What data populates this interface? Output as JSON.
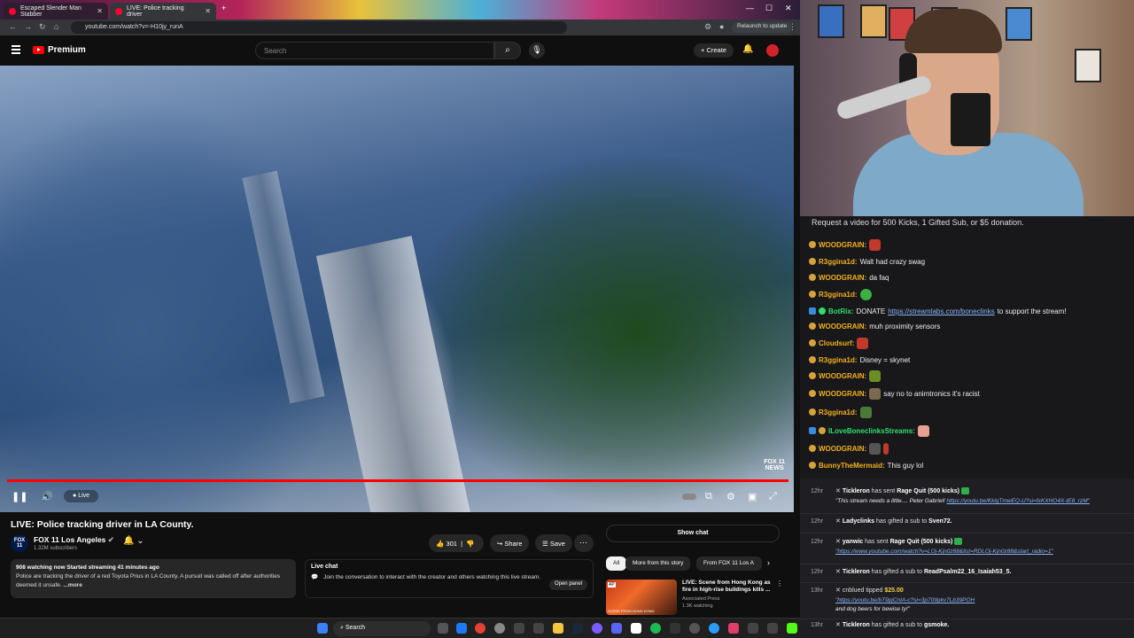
{
  "browser": {
    "tabs": [
      {
        "label": "Escaped Slender Man Stabber"
      },
      {
        "label": "LIVE: Police tracking driver"
      }
    ],
    "url": "youtube.com/watch?v=-H10jy_runA",
    "relaunch": "Relaunch to update"
  },
  "youtube": {
    "brand": "Premium",
    "search_placeholder": "Search",
    "create_label": "Create",
    "player": {
      "live_label": "Live",
      "watermark_line1": "FOX 11",
      "watermark_line2": "NEWS"
    },
    "video": {
      "title": "LIVE: Police tracking driver in LA County.",
      "channel_logo_top": "FOX",
      "channel_logo_bottom": "11",
      "channel": "FOX 11 Los Angeles",
      "subscribers": "1.32M subscribers",
      "likes": "301",
      "share_label": "Share",
      "save_label": "Save",
      "meta": "908 watching now  Started streaming 41 minutes ago",
      "description": "Police are tracking the driver of a red Toyota Prius in LA County. A pursuit was called off after authorities deemed it unsafe.",
      "more_label": "...more"
    },
    "live_chat_panel": {
      "title": "Live chat",
      "text": "Join the conversation to interact with the creator and others watching this live stream.",
      "open_panel": "Open panel"
    },
    "show_chat": "Show chat",
    "chips": [
      "All",
      "More from this story",
      "From FOX 11 Los A"
    ],
    "related": {
      "thumb_badge": "AP",
      "thumb_caption": "SCENE FROM HONG KONG",
      "title": "LIVE: Scene from Hong Kong as fire in high-rise buildings kills ...",
      "channel": "Associated Press",
      "watching": "1.3K watching"
    }
  },
  "taskbar": {
    "search": "Search"
  },
  "chat": {
    "rules_banner": "Request a video for 500 Kicks, 1 Gifted Sub, or $5 donation.",
    "messages": [
      {
        "user": "WOODGRAIN:",
        "text": "",
        "color": "#f2b01e"
      },
      {
        "user": "R3ggina1d:",
        "text": "Walt had crazy swag",
        "color": "#f2b01e"
      },
      {
        "user": "WOODGRAIN:",
        "text": "da faq",
        "color": "#f2b01e"
      },
      {
        "user": "R3ggina1d:",
        "text": "",
        "color": "#f2b01e"
      },
      {
        "user": "BotRix:",
        "text": "DONATE",
        "link": "https://streamlabs.com/boneclinks",
        "text2": "to support the stream!",
        "color": "#2ee06b"
      },
      {
        "user": "WOODGRAIN:",
        "text": "muh proximity sensors",
        "color": "#f2b01e"
      },
      {
        "user": "Cloudsurf:",
        "text": "",
        "color": "#f2b01e"
      },
      {
        "user": "R3ggina1d:",
        "text": "Disney = skynet",
        "color": "#f2b01e"
      },
      {
        "user": "WOODGRAIN:",
        "text": "",
        "color": "#f2b01e"
      },
      {
        "user": "WOODGRAIN:",
        "text": "say no to animtronics it's racist",
        "color": "#f2b01e"
      },
      {
        "user": "R3ggina1d:",
        "text": "",
        "color": "#f2b01e"
      },
      {
        "user": "ILoveBoneclinksStreams:",
        "text": "",
        "color": "#2ee06b"
      },
      {
        "user": "WOODGRAIN:",
        "text": "",
        "color": "#f2b01e"
      },
      {
        "user": "BunnyTheMermaid:",
        "text": "This guy lol",
        "color": "#f2b01e"
      }
    ]
  },
  "events": [
    {
      "time": "12hr",
      "user": "Tickleron",
      "action": "has sent",
      "item": "Rage Quit (500 kicks)",
      "sub": "\"This stream needs a little.... Peter Gabriel!",
      "link": "https://youtu.be/KkigTmwEQ-U?si=fxKXHO4X-tE8_rzM\""
    },
    {
      "time": "12hr",
      "user": "Ladyclinks",
      "action": "has gifted a sub to",
      "item": "Sven72."
    },
    {
      "time": "12hr",
      "user": "yanwic",
      "action": "has sent",
      "item": "Rage Quit (500 kicks)",
      "sub": "",
      "link": "\"https://www.youtube.com/watch?v=LOj-Kjn0z88&list=RDLOj-Kjn0z88&start_radio=1\""
    },
    {
      "time": "12hr",
      "user": "Tickleron",
      "action": "has gifted a sub to",
      "item": "ReadPsalm22_16_Isaiah53_5."
    },
    {
      "time": "13hr",
      "user": "cnblued",
      "action": "tipped",
      "item": "$25.00",
      "sub": "",
      "link": "\"https://youtu.be/bT9pjCnIA-c?si=3p709pkv7Lb39POH",
      "sub2": "and dog beers for bewise ty!\""
    },
    {
      "time": "13hr",
      "user": "Tickleron",
      "action": "has gifted a sub to",
      "item": "gsmoke."
    }
  ]
}
